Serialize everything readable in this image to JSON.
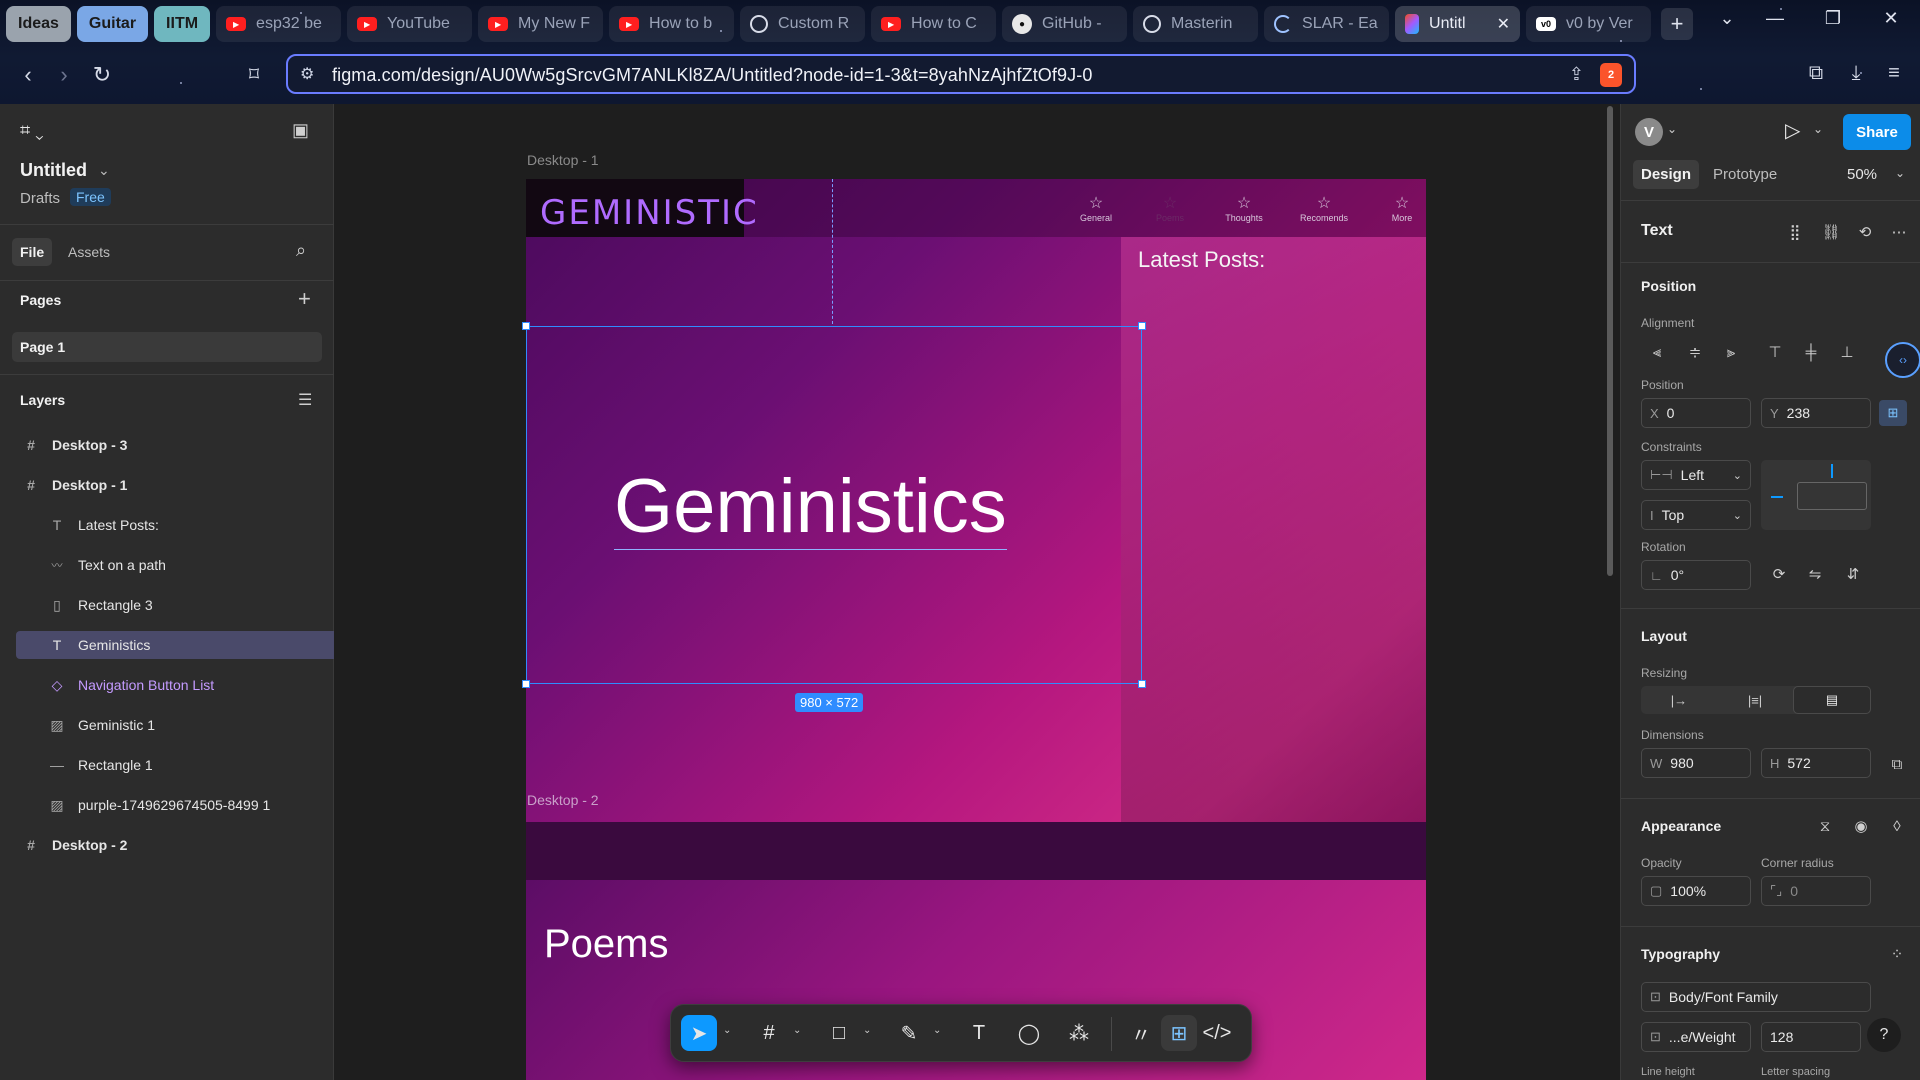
{
  "browser": {
    "tab_groups": [
      {
        "label": "Ideas",
        "color": "#9aa3ad"
      },
      {
        "label": "Guitar",
        "color": "#7aa7e6"
      },
      {
        "label": "IITM",
        "color": "#6fb7bf"
      }
    ],
    "tabs": [
      {
        "title": "esp32 be",
        "favicon": "youtube-icon"
      },
      {
        "title": "YouTube",
        "favicon": "youtube-icon"
      },
      {
        "title": "My New F",
        "favicon": "youtube-icon"
      },
      {
        "title": "How to b",
        "favicon": "youtube-icon"
      },
      {
        "title": "Custom R",
        "favicon": "openai-icon"
      },
      {
        "title": "How to C",
        "favicon": "youtube-icon"
      },
      {
        "title": "GitHub -",
        "favicon": "github-icon"
      },
      {
        "title": "Masterin",
        "favicon": "chatgpt-icon"
      },
      {
        "title": "SLAR - Ea",
        "favicon": "loading-icon"
      },
      {
        "title": "Untitl",
        "favicon": "figma-icon",
        "active": true
      },
      {
        "title": "v0 by Ver",
        "favicon": "v0-icon"
      }
    ],
    "url": "figma.com/design/AU0Ww5gSrcvGM7ANLKl8ZA/Untitled?node-id=1-3&t=8yahNzAjhfZtOf9J-0",
    "shield_count": "2"
  },
  "left_panel": {
    "file_name": "Untitled",
    "drafts_label": "Drafts",
    "plan_badge": "Free",
    "tabs": [
      "File",
      "Assets"
    ],
    "pages_heading": "Pages",
    "pages": [
      "Page 1"
    ],
    "layers_heading": "Layers",
    "layers": [
      {
        "name": "Desktop - 3",
        "icon": "frame-icon",
        "level": 0
      },
      {
        "name": "Desktop - 1",
        "icon": "frame-icon",
        "level": 0
      },
      {
        "name": "Latest Posts:",
        "icon": "text-icon",
        "level": 1
      },
      {
        "name": "Text on a path",
        "icon": "path-text-icon",
        "level": 1
      },
      {
        "name": "Rectangle 3",
        "icon": "rectangle-icon",
        "level": 1
      },
      {
        "name": "Geministics",
        "icon": "text-icon",
        "level": 1,
        "selected": true
      },
      {
        "name": "Navigation Button List",
        "icon": "component-icon",
        "level": 1,
        "component": true
      },
      {
        "name": "Geministic 1",
        "icon": "image-icon",
        "level": 1
      },
      {
        "name": "Rectangle 1",
        "icon": "line-icon",
        "level": 1
      },
      {
        "name": "purple-1749629674505-8499 1",
        "icon": "image-icon",
        "level": 1
      },
      {
        "name": "Desktop - 2",
        "icon": "frame-icon",
        "level": 0
      }
    ]
  },
  "canvas": {
    "frame1_label": "Desktop - 1",
    "frame2_label": "Desktop - 2",
    "logo_text": "GEMINISTIC",
    "nav_items": [
      "General",
      "Poems",
      "Thoughts",
      "Recomends",
      "More"
    ],
    "latest_posts": "Latest Posts:",
    "hero_title": "Geministics",
    "selection_size": "980 × 572",
    "poems_title": "Poems"
  },
  "right_panel": {
    "avatar_letter": "V",
    "share_label": "Share",
    "tabs": [
      "Design",
      "Prototype"
    ],
    "zoom": "50%",
    "section_title": "Text",
    "position_heading": "Position",
    "alignment_label": "Alignment",
    "position_label": "Position",
    "x_label": "X",
    "x_value": "0",
    "y_label": "Y",
    "y_value": "238",
    "constraints_label": "Constraints",
    "constraint_h": "Left",
    "constraint_v": "Top",
    "rotation_label": "Rotation",
    "rotation_value": "0°",
    "layout_heading": "Layout",
    "resizing_label": "Resizing",
    "dimensions_label": "Dimensions",
    "w_label": "W",
    "w_value": "980",
    "h_label": "H",
    "h_value": "572",
    "appearance_heading": "Appearance",
    "opacity_label": "Opacity",
    "opacity_value": "100%",
    "radius_label": "Corner radius",
    "radius_value": "0",
    "typography_heading": "Typography",
    "font_family_value": "Body/Font Family",
    "font_weight_value": "...e/Weight",
    "font_size_value": "128",
    "line_height_label": "Line height",
    "letter_spacing_label": "Letter spacing"
  },
  "colors": {
    "figma_accent": "#0d99ff",
    "selection_blue": "#2f8cff",
    "component_purple": "#c49bff",
    "share_blue": "#0c8ce9"
  }
}
